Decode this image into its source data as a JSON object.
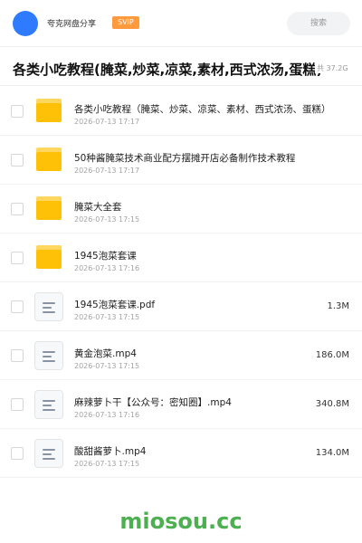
{
  "header": {
    "title": "夸克网盘分享",
    "badge": "SVIP",
    "search_placeholder": "搜索"
  },
  "folder": {
    "title": "各类小吃教程(腌菜,炒菜,凉菜,素材,西式浓汤,蛋糕)",
    "total_size": "37.2G"
  },
  "items": [
    {
      "type": "folder",
      "name": "各类小吃教程（腌菜、炒菜、凉菜、素材、西式浓汤、蛋糕）",
      "date": "2026-07-13 17:17",
      "size": ""
    },
    {
      "type": "folder",
      "name": "50种酱腌菜技术商业配方摆摊开店必备制作技术教程",
      "date": "2026-07-13 17:17",
      "size": ""
    },
    {
      "type": "folder",
      "name": "腌菜大全套",
      "date": "2026-07-13 17:15",
      "size": ""
    },
    {
      "type": "folder",
      "name": "1945泡菜套课",
      "date": "2026-07-13 17:16",
      "size": ""
    },
    {
      "type": "file",
      "name": "1945泡菜套课.pdf",
      "date": "2026-07-13 17:15",
      "size": "1.3M"
    },
    {
      "type": "file",
      "name": "黄金泡菜.mp4",
      "date": "2026-07-13 17:15",
      "size": "186.0M"
    },
    {
      "type": "file",
      "name": "麻辣萝卜干【公众号：密知圈】.mp4",
      "date": "2026-07-13 17:16",
      "size": "340.8M"
    },
    {
      "type": "file",
      "name": "酸甜酱萝卜.mp4",
      "date": "2026-07-13 17:15",
      "size": "134.0M"
    }
  ],
  "watermark": "miosou.cc",
  "colors": {
    "accent": "#2f7bff",
    "badge": "#ff9a3d",
    "folder": "#ffc107",
    "watermark": "#4caf50"
  }
}
